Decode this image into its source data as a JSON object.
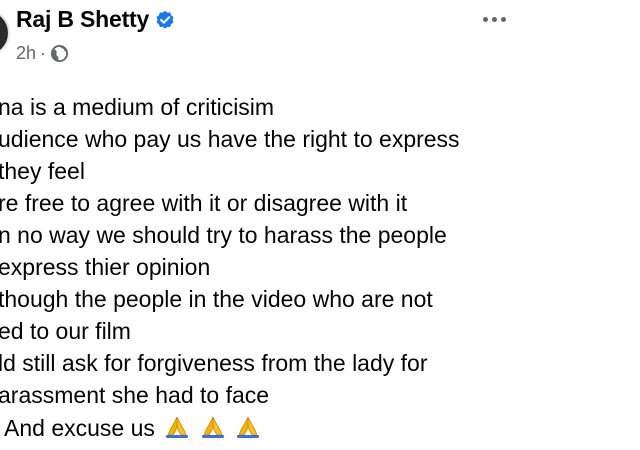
{
  "post": {
    "author": "Raj B Shetty",
    "time": "2h",
    "separator": "·",
    "icons": {
      "verified": "verified-badge-icon",
      "audience": "globe-icon",
      "more": "more-options-icon",
      "emoji": "folded-hands-emoji"
    },
    "colors": {
      "verified": "#1877f2",
      "secondary_text": "#65676b",
      "emoji": "#f4b400"
    },
    "lines": [
      "na is a medium of criticisim",
      "udience who pay us have the right to express",
      "they feel",
      "re free to agree with it or disagree with it",
      "n no way we should try to harass the people",
      "express thier opinion",
      "though the people in the video who are not",
      "ed to our film",
      "ld still ask for forgiveness from the lady for",
      "arassment she had to face",
      "And excuse us"
    ]
  }
}
